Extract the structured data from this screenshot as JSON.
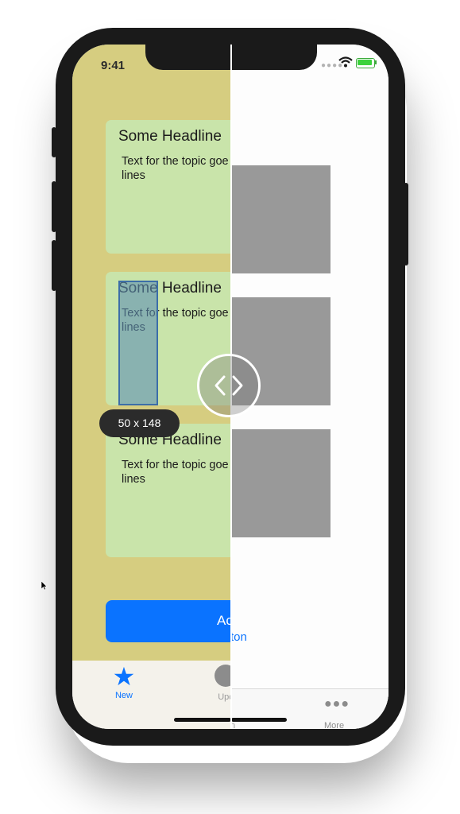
{
  "status_bar": {
    "time": "9:41"
  },
  "cards": [
    {
      "headline": "Some Headline",
      "text": "Text for the topic goe and have many lines"
    },
    {
      "headline": "Some Headline",
      "text": "Text for the topic goe and have many lines"
    },
    {
      "headline": "Some Headline",
      "text": "Text for the topic goe and have many lines"
    }
  ],
  "action_button": {
    "label_left": "Ac",
    "label_right_fragment": "ton"
  },
  "tabbar": {
    "tabs": [
      {
        "label": "New",
        "icon": "star-icon"
      },
      {
        "label": "Upc",
        "icon": "circle-icon"
      },
      {
        "label": "n",
        "icon": ""
      },
      {
        "label": "More",
        "icon": "more-dots-icon"
      }
    ]
  },
  "inspector": {
    "size_badge": "50 x 148"
  },
  "colors": {
    "background_left": "#d6cd80",
    "card_bg": "#c9e4aa",
    "accent": "#0a73ff",
    "placeholder_gray": "#999999"
  }
}
